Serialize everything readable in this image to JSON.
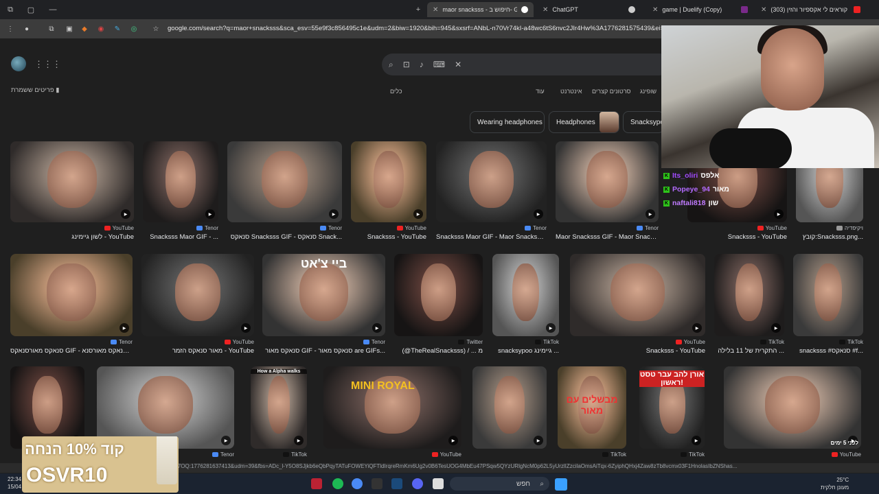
{
  "browser": {
    "tabs": [
      {
        "label": "maor snacksss - חיפוש ב- Goog",
        "active": true
      },
      {
        "label": "ChatGPT",
        "active": false
      },
      {
        "label": "game | Duelify (Copy)",
        "active": false
      },
      {
        "label": "(303) קוראים לי אקספיור והזין",
        "active": false
      }
    ],
    "url": "google.com/search?q=maor+snacksss&sca_esv=55e9f3c856495c1e&udm=2&biw=1920&bih=945&sxsrf=ANbL-n70Vr74kI-a48wc6tS6nvc2JIr4Hw%3A1776281575439&ei=5-f"
  },
  "google": {
    "saved": "פריטים ששמרת",
    "filters": [
      "כלים",
      "עוד",
      "אינטרנט",
      "סרטונים קצרים",
      "שופינג"
    ],
    "chips": [
      "Wearing headphones",
      "Headphones",
      "Snacksypo"
    ],
    "row1": [
      {
        "src": "YouTube",
        "title": "לשון גיימינג - YouTube"
      },
      {
        "src": "Tenor",
        "title": "Snacksss Maor GIF - ..."
      },
      {
        "src": "Tenor",
        "title": "סנאקס Snacksss GIF - סנאקס Snack..."
      },
      {
        "src": "YouTube",
        "title": "Snacksss - YouTube"
      },
      {
        "src": "Tenor",
        "title": "Snacksss Maor GIF - Maor Snacksss GIF - S..."
      },
      {
        "src": "Tenor",
        "title": "Maor Snacksss GIF - Maor Snacksss ..."
      },
      {
        "src": "YouTube",
        "title": "Snacksss - YouTube"
      },
      {
        "src": "ויקיפדיה",
        "title": "קובץ:Snacksss.png..."
      }
    ],
    "row2": [
      {
        "src": "Tenor",
        "title": "סנאקס מאורסנאקס GIF - סנאקס מאורסנא..."
      },
      {
        "src": "YouTube",
        "title": "מאור סנאקס הזמר - YouTube"
      },
      {
        "src": "Tenor",
        "title": "סנאקס מאור GIF - סנאקס מאור are GIFs..."
      },
      {
        "src": "Twitter",
        "title": "(@TheRealSnacksss) / ... מ"
      },
      {
        "src": "TikTok",
        "title": "snacksypoo גיימינג ..."
      },
      {
        "src": "YouTube",
        "title": "Snacksss - YouTube"
      },
      {
        "src": "TikTok",
        "title": "התקרית של 11 בלילה ..."
      },
      {
        "src": "TikTok",
        "title": "snacksss #סנאקס #f..."
      }
    ],
    "row3": [
      {
        "src": "",
        "title": ""
      },
      {
        "src": "Tenor",
        "title": ""
      },
      {
        "src": "TikTok",
        "title": ""
      },
      {
        "src": "YouTube",
        "title": ""
      },
      {
        "src": "",
        "title": ""
      },
      {
        "src": "TikTok",
        "title": ""
      },
      {
        "src": "TikTok",
        "title": ""
      },
      {
        "src": "YouTube",
        "title": ""
      }
    ],
    "overlays": {
      "r2_3": "ביי צ'אט",
      "r3_6": "מבשלים עם מאור",
      "r3_7": "אורן להב עבר טסט ראשון!",
      "r3_8": "לפני 5 ימים",
      "r3_4": "MINI ROYAL",
      "r3_3": "How a Alpha walks"
    }
  },
  "stream_chat": [
    {
      "user": "Its_oliri",
      "msg": "אלפס"
    },
    {
      "user": "Popeye_94",
      "msg": "מאור"
    },
    {
      "user": "naftali818",
      "msg": "שון"
    }
  ],
  "ad": {
    "line1": "קוד 10% הנחה",
    "line2": "OSVR10"
  },
  "status_url": "1920&bih=945&sxsrf=ANbL-n7F_3fEL-RrwXEQdfQuOLW_-ne7OQ:1776281637413&udm=39&fbs=ADc_l-Y5O8SJjkb6eQbPqyTATuFOWEYiQFTldIrqreRmKm6Ug2v0B6TesUOG4MbEu47PSqw5QYzURlgNcM0p62L5yUrzlIZzcilaOmsAiTqx-6ZyiphQHxj4Zaw8zTb8vcmx03F1HnolasIbZNShas...",
  "taskbar": {
    "time": "22:34",
    "date": "15/04",
    "search": "חפש",
    "temp": "25°C",
    "weather": "מעונן חלקית"
  }
}
